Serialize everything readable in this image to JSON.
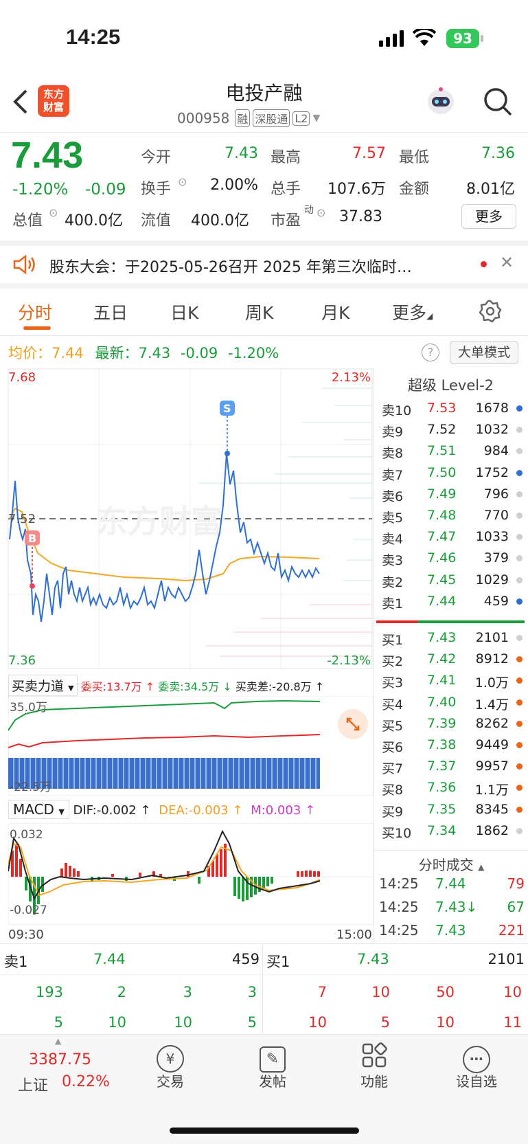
{
  "status_bar": {
    "time": "14:25",
    "battery": "93"
  },
  "header": {
    "broker_logo": "东方\n财富",
    "title": "电投产融",
    "code": "000958",
    "tags": [
      "融",
      "深股通",
      "L2"
    ]
  },
  "quote": {
    "price": "7.43",
    "change_pct": "-1.20%",
    "change": "-0.09",
    "stats": [
      {
        "label": "今开",
        "value": "7.43",
        "color": "green"
      },
      {
        "label": "最高",
        "value": "7.57",
        "color": "red"
      },
      {
        "label": "最低",
        "value": "7.36",
        "color": "green"
      },
      {
        "label": "换手",
        "value": "2.00%",
        "color": "black"
      },
      {
        "label": "总手",
        "value": "107.6万",
        "color": "black"
      },
      {
        "label": "金额",
        "value": "8.01亿",
        "color": "black"
      },
      {
        "label": "总值",
        "value": "400.0亿",
        "color": "black"
      },
      {
        "label": "流值",
        "value": "400.0亿",
        "color": "black"
      },
      {
        "label": "市盈",
        "sup": "动",
        "value": "37.83",
        "color": "black"
      }
    ],
    "more_button": "更多"
  },
  "notice": {
    "text": "股东大会：于2025-05-26召开 2025 年第三次临时…"
  },
  "tabs": [
    "分时",
    "五日",
    "日K",
    "周K",
    "月K",
    "更多"
  ],
  "chart_header": {
    "avg_label": "均价：",
    "avg_value": "7.44",
    "latest_label": "最新：",
    "latest_value": "7.43",
    "latest_change": "-0.09",
    "latest_pct": "-1.20%",
    "mode_button": "大单模式"
  },
  "chart_labels": {
    "high": "7.68",
    "mid": "7.52",
    "low": "7.36",
    "pct_high": "2.13%",
    "pct_low": "-2.13%",
    "start_time": "09:30",
    "end_time": "15:00",
    "buy_marker": "B",
    "sell_marker": "S",
    "watermark": "东方财富"
  },
  "force_panel": {
    "title": "买卖力道",
    "wei_buy": "委买:13.7万 ↑",
    "wei_sell": "委卖:34.5万 ↓",
    "diff": "买卖差:-20.8万 ↑",
    "top": "35.0万",
    "bottom": "-22.5万"
  },
  "macd_panel": {
    "title": "MACD",
    "dif": "DIF:-0.002 ↑",
    "dea": "DEA:-0.003 ↑",
    "m": "M:0.003 ↑",
    "top": "0.032",
    "bottom": "-0.027"
  },
  "orderbook": {
    "title": "超级 Level-2",
    "sells": [
      {
        "label": "卖10",
        "price": "7.53",
        "vol": "1678",
        "pc": "red",
        "dot": "#2f6fd0"
      },
      {
        "label": "卖9",
        "price": "7.52",
        "vol": "1032",
        "pc": "black",
        "dot": "#cfcfcf"
      },
      {
        "label": "卖8",
        "price": "7.51",
        "vol": "984",
        "pc": "green",
        "dot": "#cfcfcf"
      },
      {
        "label": "卖7",
        "price": "7.50",
        "vol": "1752",
        "pc": "green",
        "dot": "#2f6fd0"
      },
      {
        "label": "卖6",
        "price": "7.49",
        "vol": "796",
        "pc": "green",
        "dot": "#cfcfcf"
      },
      {
        "label": "卖5",
        "price": "7.48",
        "vol": "770",
        "pc": "green",
        "dot": "#cfcfcf"
      },
      {
        "label": "卖4",
        "price": "7.47",
        "vol": "1033",
        "pc": "green",
        "dot": "#cfcfcf"
      },
      {
        "label": "卖3",
        "price": "7.46",
        "vol": "379",
        "pc": "green",
        "dot": "#cfcfcf"
      },
      {
        "label": "卖2",
        "price": "7.45",
        "vol": "1029",
        "pc": "green",
        "dot": "#cfcfcf"
      },
      {
        "label": "卖1",
        "price": "7.44",
        "vol": "459",
        "pc": "green",
        "dot": "#2f6fd0"
      }
    ],
    "buys": [
      {
        "label": "买1",
        "price": "7.43",
        "vol": "2101",
        "pc": "green",
        "dot": "#cfcfcf"
      },
      {
        "label": "买2",
        "price": "7.42",
        "vol": "8912",
        "pc": "green",
        "dot": "#e8661a"
      },
      {
        "label": "买3",
        "price": "7.41",
        "vol": "1.0万",
        "pc": "green",
        "dot": "#e8661a"
      },
      {
        "label": "买4",
        "price": "7.40",
        "vol": "1.4万",
        "pc": "green",
        "dot": "#e8661a"
      },
      {
        "label": "买5",
        "price": "7.39",
        "vol": "8262",
        "pc": "green",
        "dot": "#e8661a"
      },
      {
        "label": "买6",
        "price": "7.38",
        "vol": "9449",
        "pc": "green",
        "dot": "#e8661a"
      },
      {
        "label": "买7",
        "price": "7.37",
        "vol": "9957",
        "pc": "green",
        "dot": "#e8661a"
      },
      {
        "label": "买8",
        "price": "7.36",
        "vol": "1.1万",
        "pc": "green",
        "dot": "#e8661a"
      },
      {
        "label": "买9",
        "price": "7.35",
        "vol": "8345",
        "pc": "green",
        "dot": "#e8661a"
      },
      {
        "label": "买10",
        "price": "7.34",
        "vol": "1862",
        "pc": "green",
        "dot": "#cfcfcf"
      }
    ]
  },
  "ticks": {
    "title": "分时成交",
    "rows": [
      {
        "time": "14:25",
        "price": "7.44",
        "vol": "79",
        "vc": "red"
      },
      {
        "time": "14:25",
        "price": "7.43↓",
        "vol": "67",
        "vc": "green"
      },
      {
        "time": "14:25",
        "price": "7.43",
        "vol": "221",
        "vc": "red"
      }
    ]
  },
  "queue": {
    "sell_label": "卖1",
    "sell_price": "7.44",
    "sell_vol": "459",
    "buy_label": "买1",
    "buy_price": "7.43",
    "buy_vol": "2101",
    "sell_row1": [
      "193",
      "2",
      "3",
      "3"
    ],
    "sell_row2": [
      "5",
      "10",
      "10",
      "5"
    ],
    "buy_row1": [
      "7",
      "10",
      "50",
      "10"
    ],
    "buy_row2": [
      "10",
      "5",
      "10",
      "11"
    ]
  },
  "bottom_bar": {
    "index_value": "3387.75",
    "index_name": "上证",
    "index_pct": "0.22%",
    "tabs": [
      {
        "label": "交易",
        "icon": "¥"
      },
      {
        "label": "发帖",
        "icon": "✎"
      },
      {
        "label": "功能",
        "icon": "⊞"
      },
      {
        "label": "设自选",
        "icon": "⋯"
      }
    ]
  }
}
